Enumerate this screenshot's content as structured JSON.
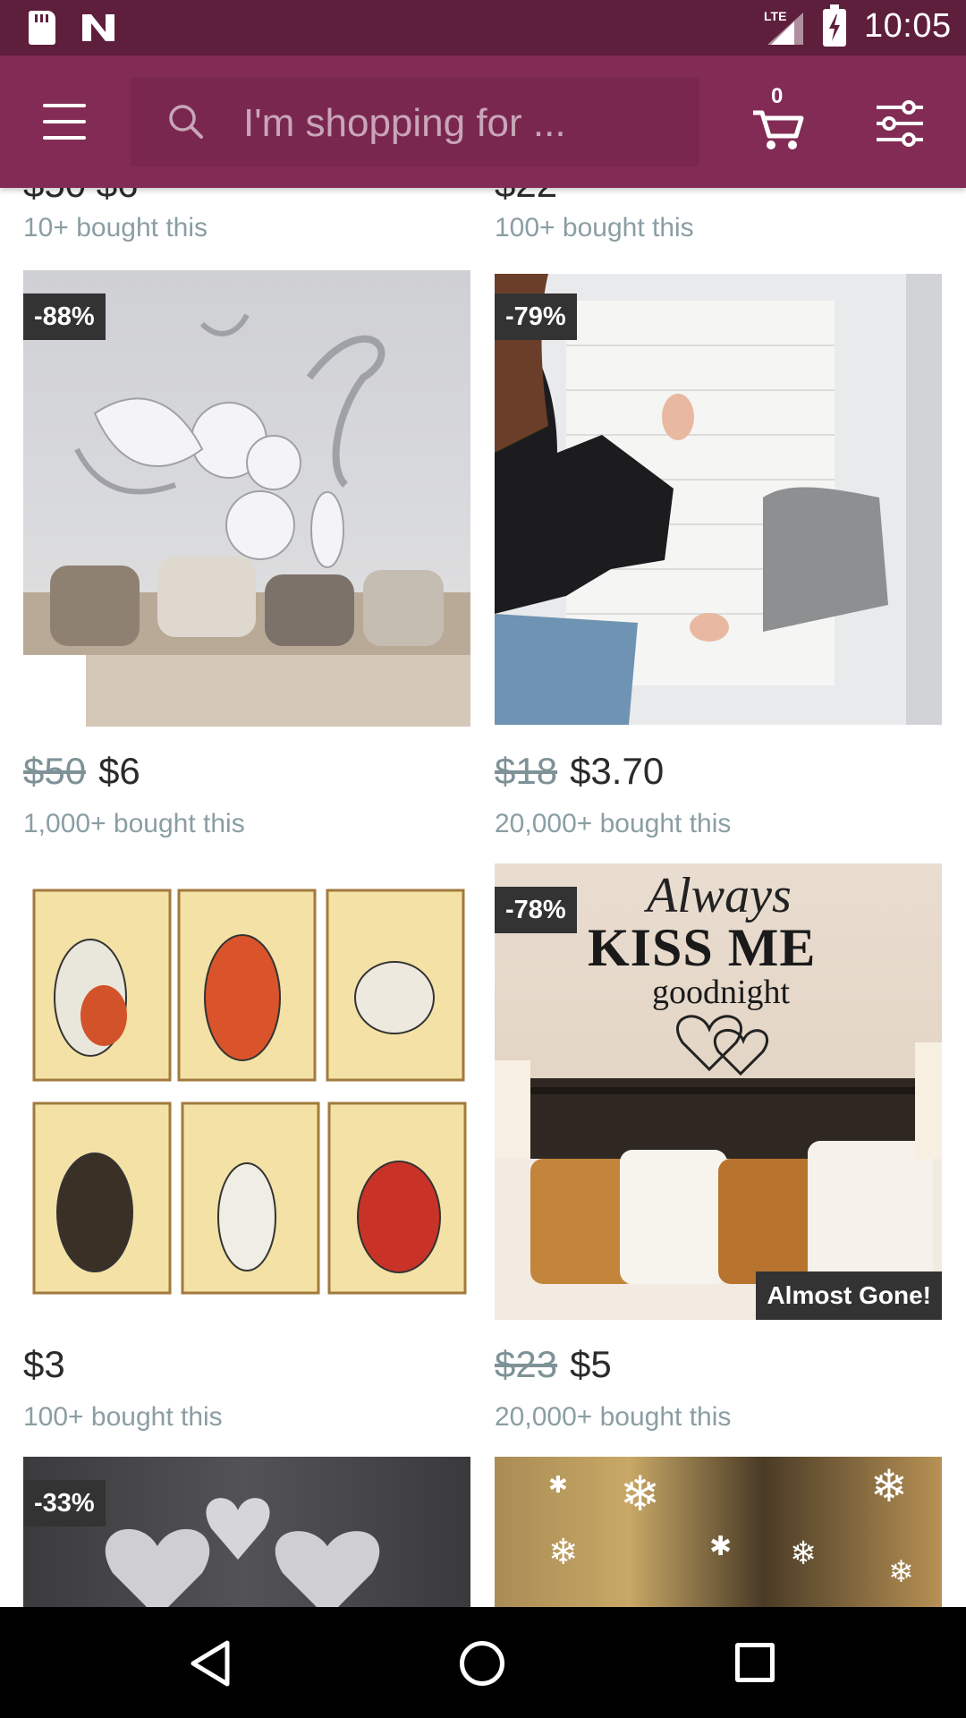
{
  "status_bar": {
    "network": "LTE",
    "time": "10:05"
  },
  "app_bar": {
    "search_placeholder": "I'm shopping for ...",
    "cart_count": "0"
  },
  "partial_row": [
    {
      "price_fragment": "$50 $6",
      "bought": "10+ bought this"
    },
    {
      "price_fragment": "$22",
      "bought": "100+ bought this"
    }
  ],
  "products": [
    {
      "badge": "-88%",
      "old_price": "$50",
      "price": "$6",
      "bought": "1,000+ bought this",
      "image": "3D mirror flower wall sticker above sofa",
      "stock_label": ""
    },
    {
      "badge": "-79%",
      "old_price": "$18",
      "price": "$3.70",
      "bought": "20,000+ bought this",
      "image": "woman applying white 3D brick foam wall panel",
      "stock_label": ""
    },
    {
      "badge": "",
      "old_price": "",
      "price": "$3",
      "bought": "100+ bought this",
      "image": "six tattooed cat art prints",
      "stock_label": ""
    },
    {
      "badge": "-78%",
      "old_price": "$23",
      "price": "$5",
      "bought": "20,000+ bought this",
      "image": "Always Kiss Me Goodnight wall decal over bed",
      "stock_label": "Almost Gone!"
    },
    {
      "badge": "-33%",
      "old_price": "",
      "price": "",
      "bought": "",
      "image": "silver heart mirror stickers",
      "stock_label": ""
    },
    {
      "badge": "",
      "old_price": "",
      "price": "",
      "bought": "",
      "image": "snowflake window stickers",
      "stock_label": ""
    }
  ],
  "decal_text": {
    "line1": "Always",
    "line2": "KISS ME",
    "line3": "goodnight"
  },
  "colors": {
    "status_bar": "#5e1f3d",
    "app_bar": "#822c55",
    "badge": "#333333"
  },
  "icons": [
    "menu-icon",
    "search-icon",
    "cart-icon",
    "filter-icon",
    "back-icon",
    "home-icon",
    "recents-icon"
  ]
}
